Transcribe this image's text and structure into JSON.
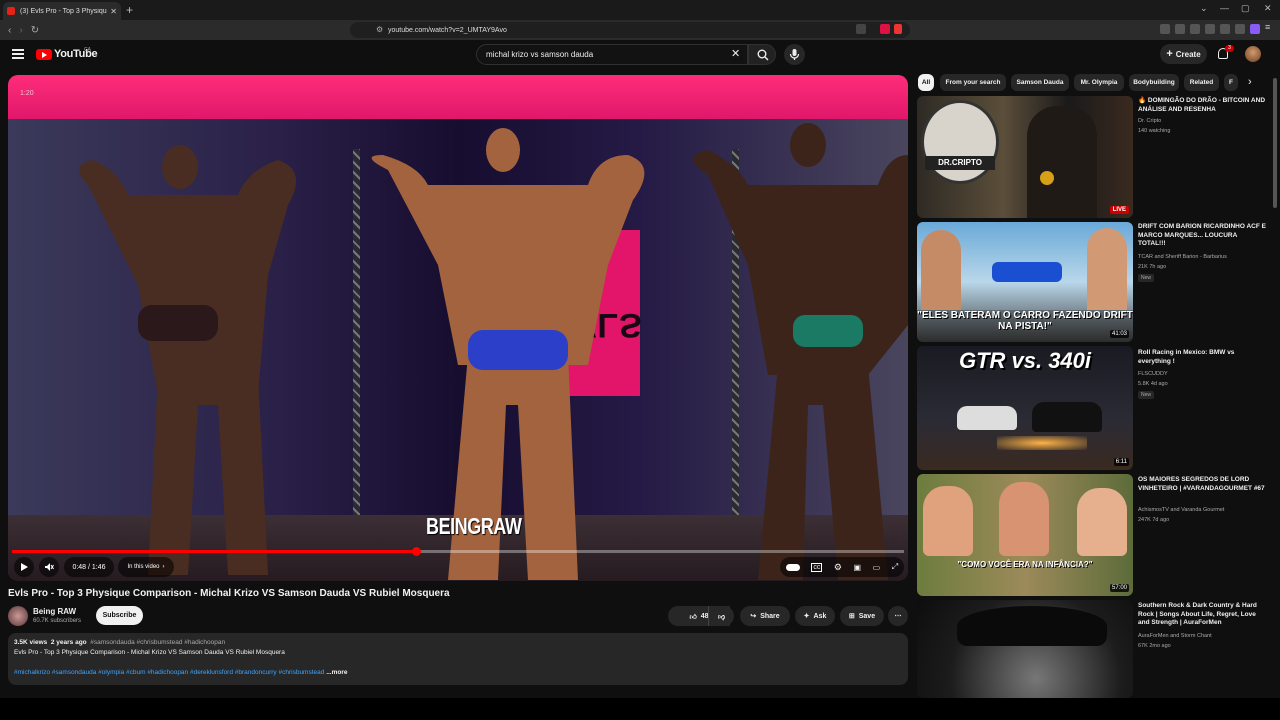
{
  "browser": {
    "tab_title": "(3) Evls Pro - Top 3 Physique Co...",
    "url": "youtube.com/watch?v=2_UMTAY9Avo"
  },
  "header": {
    "logo": "YouTube",
    "country": "CA",
    "search_query": "michal krizo vs samson dauda",
    "create_label": "Create",
    "notification_count": "3"
  },
  "player": {
    "corner_time": "1:20",
    "banner_text": "EVLS",
    "watermark": "BEINGRAW",
    "time_display": "0:48 / 1:46",
    "in_this_video": "In this video",
    "progress_fraction": 0.4528
  },
  "video": {
    "title": "Evls Pro - Top 3 Physique Comparison - Michal Krizo VS Samson Dauda VS Rubiel Mosquera",
    "channel": "Being RAW",
    "subscribers": "60.7K subscribers",
    "subscribe": "Subscribe",
    "likes": "48",
    "share": "Share",
    "ask": "Ask",
    "save": "Save"
  },
  "description": {
    "views": "3.5K views",
    "age": "2 years ago",
    "hashtags_top": "#samsondauda #chrisbumstead #hadichoopan",
    "line": "Evls Pro - Top 3 Physique Comparison - Michal Krizo VS Samson Dauda VS Rubiel Mosquera",
    "hashtags": "#michalkrizo #samsondauda #olympia #cbum #hadichoopan #dereklunsford #brandoncurry #chrisbumstead",
    "more": "...more"
  },
  "chips": [
    "All",
    "From your search",
    "Samson Dauda",
    "Mr. Olympia",
    "Bodybuilding",
    "Related",
    "F"
  ],
  "recommendations": [
    {
      "title": "🔥 DOMINGÃO DO DRÃO - BITCOIN AND ANÁLISE AND RESENHA",
      "channel": "Dr. Cripto",
      "meta": "140 watching",
      "badge": "LIVE",
      "thumb_text": "DR.CRIPTO",
      "duration": ""
    },
    {
      "title": "DRIFT COM BARION RICARDINHO ACF E MARCO MARQUES... LOUCURA TOTAL!!!",
      "channel": "TCAR and Sheriff Barion - Barbarius",
      "meta": "21K  7h ago",
      "badge": "New",
      "thumb_text": "\"ELES BATERAM O CARRO FAZENDO DRIFT NA PISTA!\"",
      "duration": "41:03"
    },
    {
      "title": "Roll Racing in Mexico: BMW vs everything !",
      "channel": "FLSCUDDY",
      "meta": "5.8K  4d ago",
      "badge": "New",
      "thumb_text": "GTR vs. 340i",
      "duration": "6:11"
    },
    {
      "title": "OS MAIORES SEGREDOS DE LORD VINHETEIRO | #VARANDAGOURMET #67",
      "channel": "AchismosTV and Varanda Gourmet",
      "meta": "247K  7d ago",
      "badge": "",
      "thumb_text": "\"COMO VOCÊ ERA NA INFÂNCIA?\"",
      "duration": "57:00"
    },
    {
      "title": "Southern Rock & Dark Country & Hard Rock | Songs About Life, Regret, Love and Strength | AuraForMen",
      "channel": "AuraForMen and Storm Chant",
      "meta": "67K  2mo ago",
      "badge": "",
      "thumb_text": "",
      "duration": ""
    }
  ],
  "colors": {
    "accent": "#ff0000",
    "banner_pink": "#e2156a",
    "link": "#3ea6ff"
  }
}
